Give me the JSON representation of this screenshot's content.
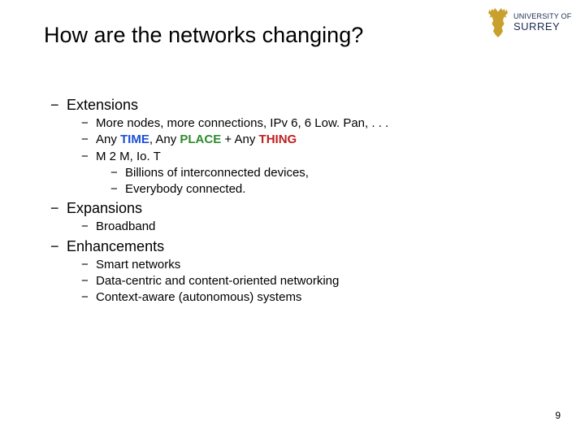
{
  "logo": {
    "line1": "UNIVERSITY OF",
    "line2": "SURREY"
  },
  "title": "How are the networks changing?",
  "bullets": {
    "extensions": {
      "label": "Extensions",
      "b1_pre": "More nodes, more connections, IPv 6, 6 Low. Pan, . . .",
      "b2": {
        "pre1": "Any ",
        "time": "TIME",
        "mid1": ", Any ",
        "place": "PLACE",
        "plus": " + ",
        "pre2": "Any ",
        "thing": "THING"
      },
      "b3": "M 2 M, Io. T",
      "b3_sub1": "Billions of interconnected devices,",
      "b3_sub2": "Everybody connected."
    },
    "expansions": {
      "label": "Expansions",
      "b1": "Broadband"
    },
    "enhancements": {
      "label": "Enhancements",
      "b1": "Smart networks",
      "b2": "Data-centric and content-oriented networking",
      "b3": "Context-aware (autonomous) systems"
    }
  },
  "page_number": "9"
}
